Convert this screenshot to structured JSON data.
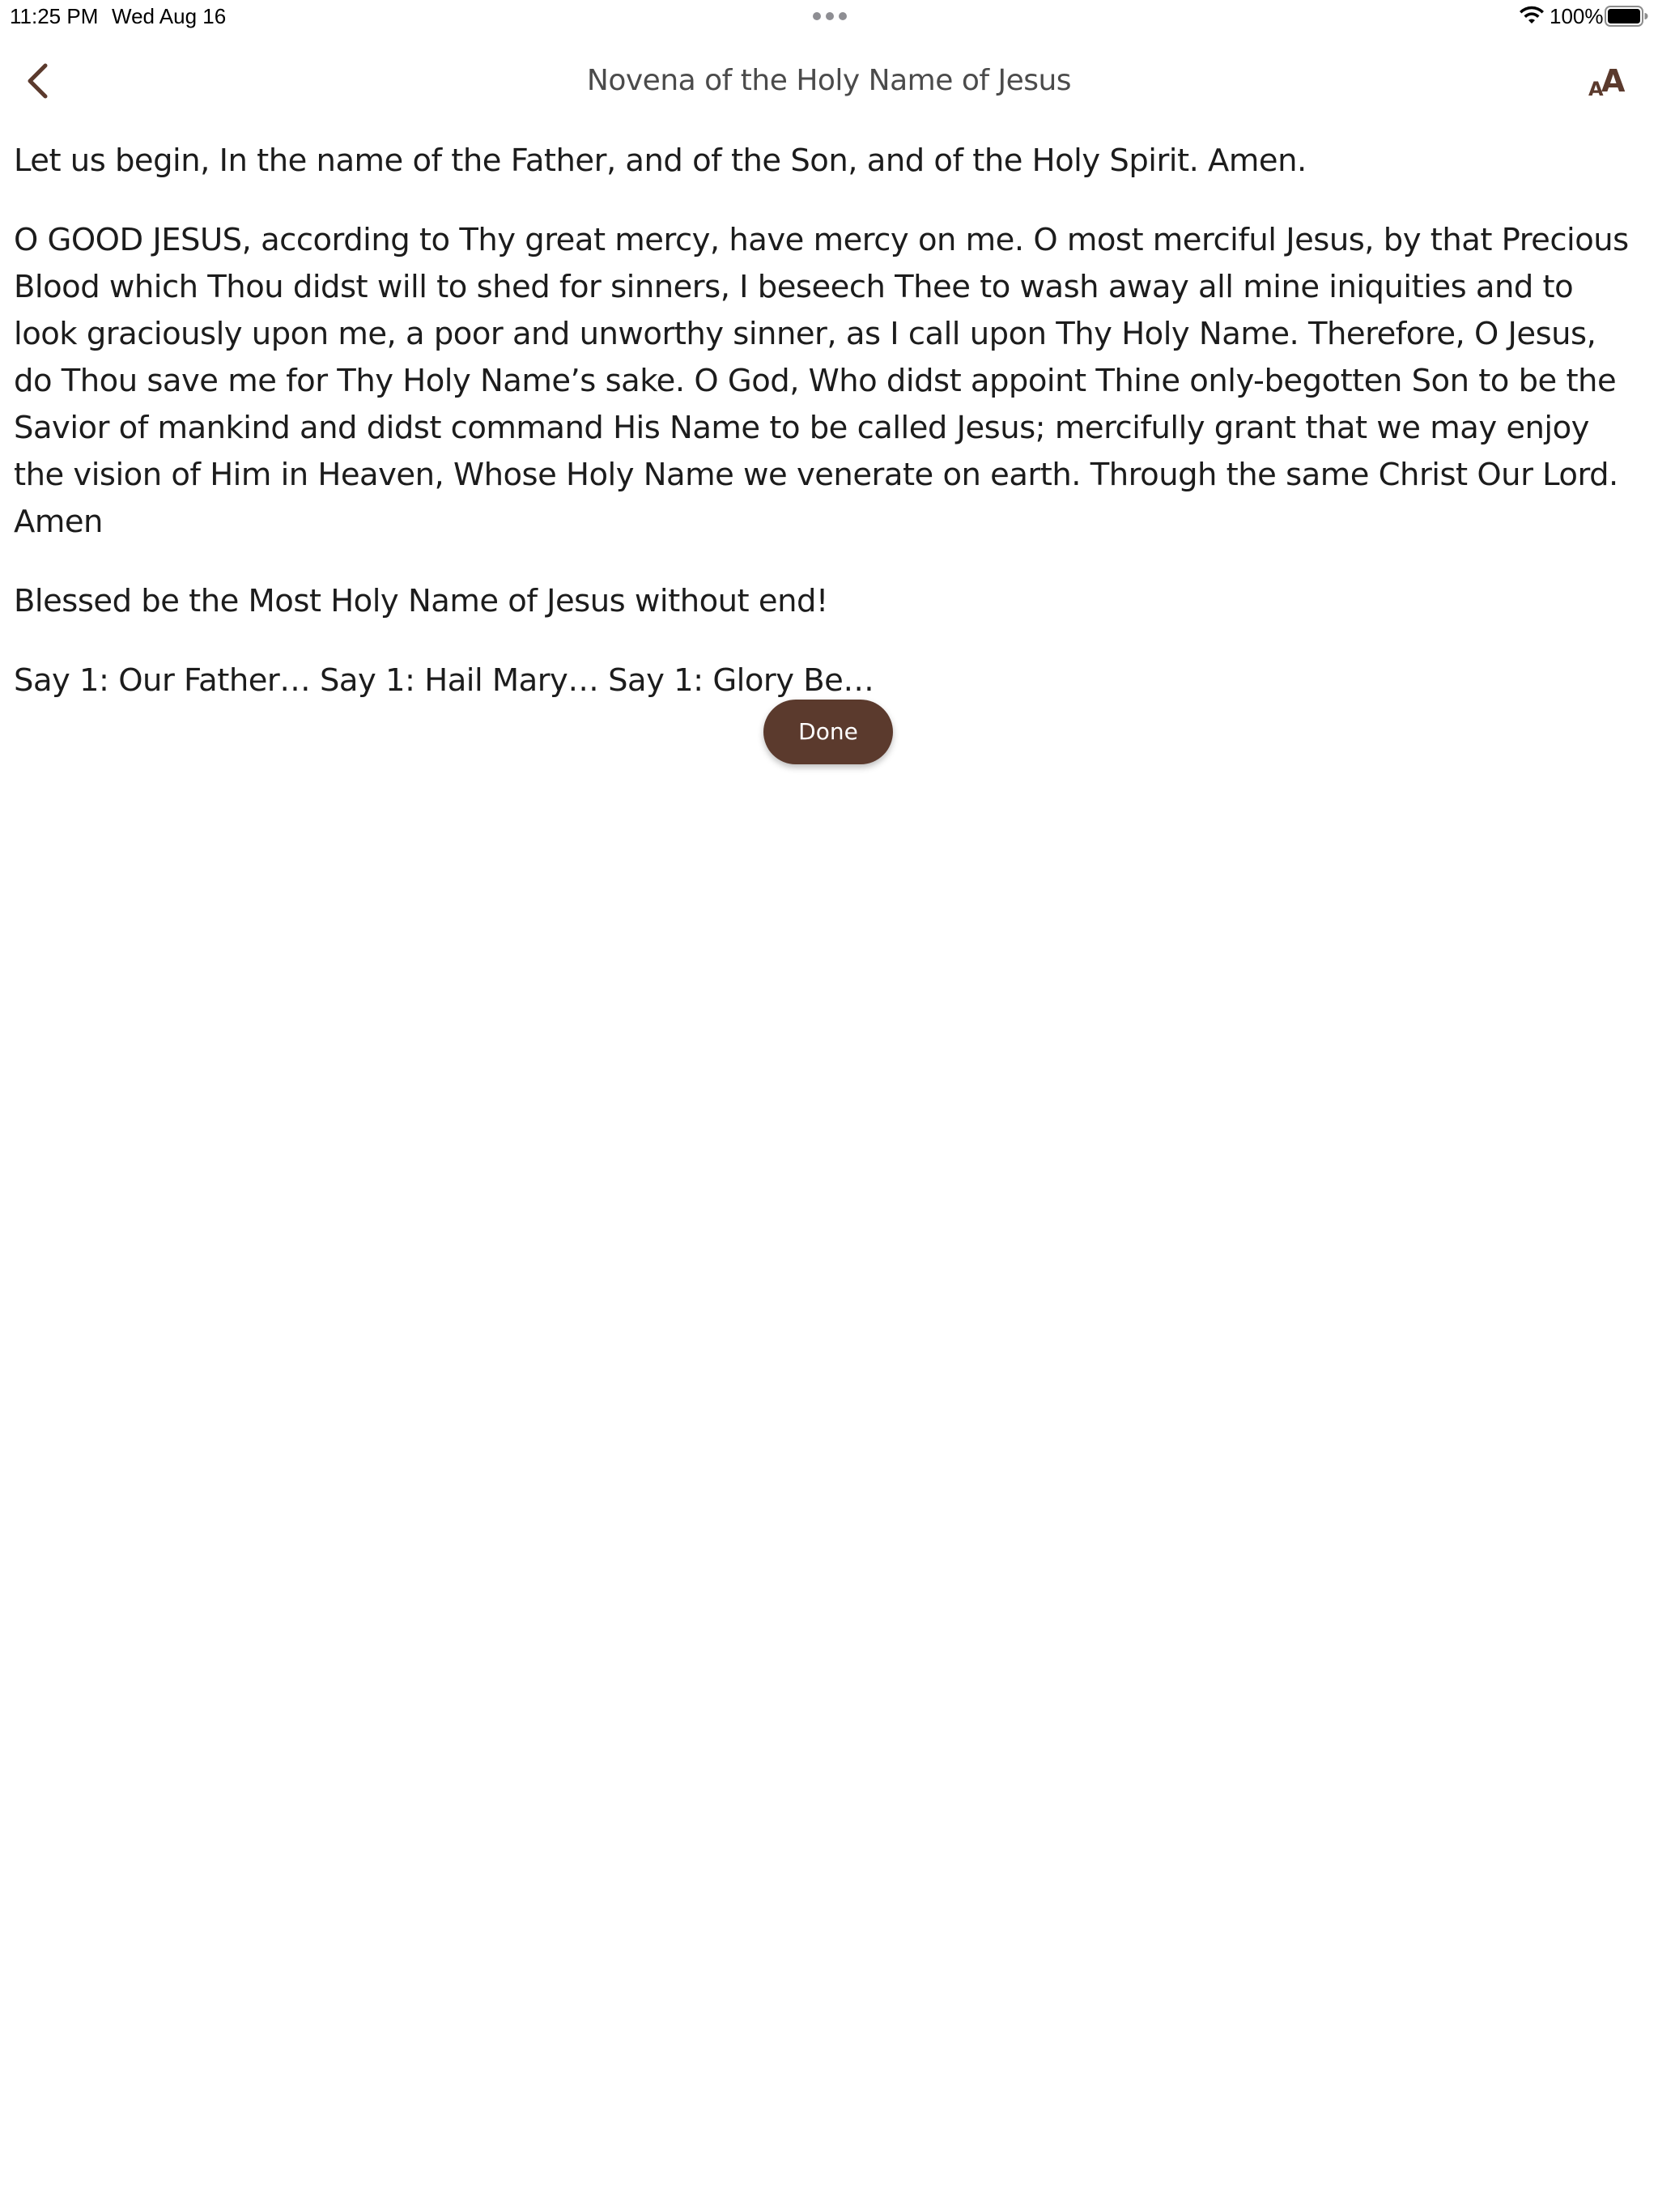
{
  "status_bar": {
    "time": "11:25 PM",
    "date": "Wed Aug 16",
    "battery_percent": "100%",
    "battery_level": 1.0,
    "icons": [
      "multitask-dots-icon",
      "wifi-icon",
      "battery-icon"
    ]
  },
  "nav": {
    "title": "Novena of the Holy Name of Jesus",
    "back_icon": "chevron-left-icon",
    "font_size_icon": "text-size-icon",
    "font_size_small": "A",
    "font_size_large": "A"
  },
  "content": {
    "paragraphs": [
      "Let us begin, In the name of the Father, and of the Son, and of the Holy Spirit. Amen.",
      "O GOOD JESUS, according to Thy great mercy, have mercy on me. O most merciful Jesus, by that Precious Blood which Thou didst will to shed for sinners, I beseech Thee to wash away all mine iniquities and to look graciously upon me, a poor and unworthy sinner, as I call upon Thy Holy Name. Therefore, O Jesus, do Thou save me for Thy Holy Name’s sake. O God, Who didst appoint Thine only-begotten Son to be the Savior of mankind and didst command His Name to be called Jesus; mercifully grant that we may enjoy the vision of Him in Heaven, Whose Holy Name we venerate on earth. Through the same Christ Our Lord. Amen",
      "Blessed be the Most Holy Name of Jesus without end!",
      "Say 1: Our Father…  Say 1: Hail Mary… Say 1: Glory Be…"
    ]
  },
  "actions": {
    "done_label": "Done"
  },
  "colors": {
    "accent": "#5b3a2d",
    "text": "#1c1c1c",
    "title": "#4b4b4b",
    "background": "#ffffff"
  }
}
